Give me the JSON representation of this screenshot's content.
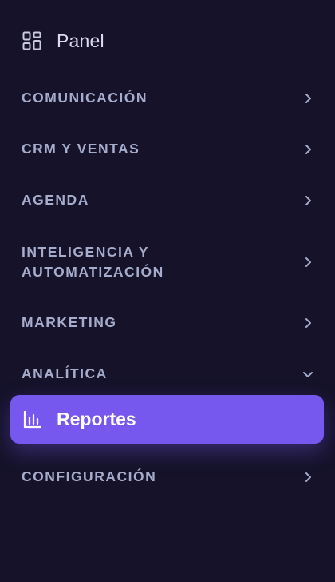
{
  "sidebar": {
    "panel": {
      "label": "Panel",
      "icon": "grid-icon"
    },
    "sections": [
      {
        "label": "COMUNICACIÓN",
        "expanded": false
      },
      {
        "label": "CRM Y VENTAS",
        "expanded": false
      },
      {
        "label": "AGENDA",
        "expanded": false
      },
      {
        "label_line1": "INTELIGENCIA Y",
        "label_line2": "AUTOMATIZACIÓN",
        "expanded": false
      },
      {
        "label": "MARKETING",
        "expanded": false
      },
      {
        "label": "ANALÍTICA",
        "expanded": true
      },
      {
        "label": "CONFIGURACIÓN",
        "expanded": false
      }
    ],
    "active_item": {
      "label": "Reportes",
      "icon": "bar-chart-icon"
    }
  },
  "colors": {
    "background": "#15122a",
    "section_text": "#a6accb",
    "panel_text": "#dcdcec",
    "active_background": "#7758ee",
    "active_text": "#ffffff"
  }
}
